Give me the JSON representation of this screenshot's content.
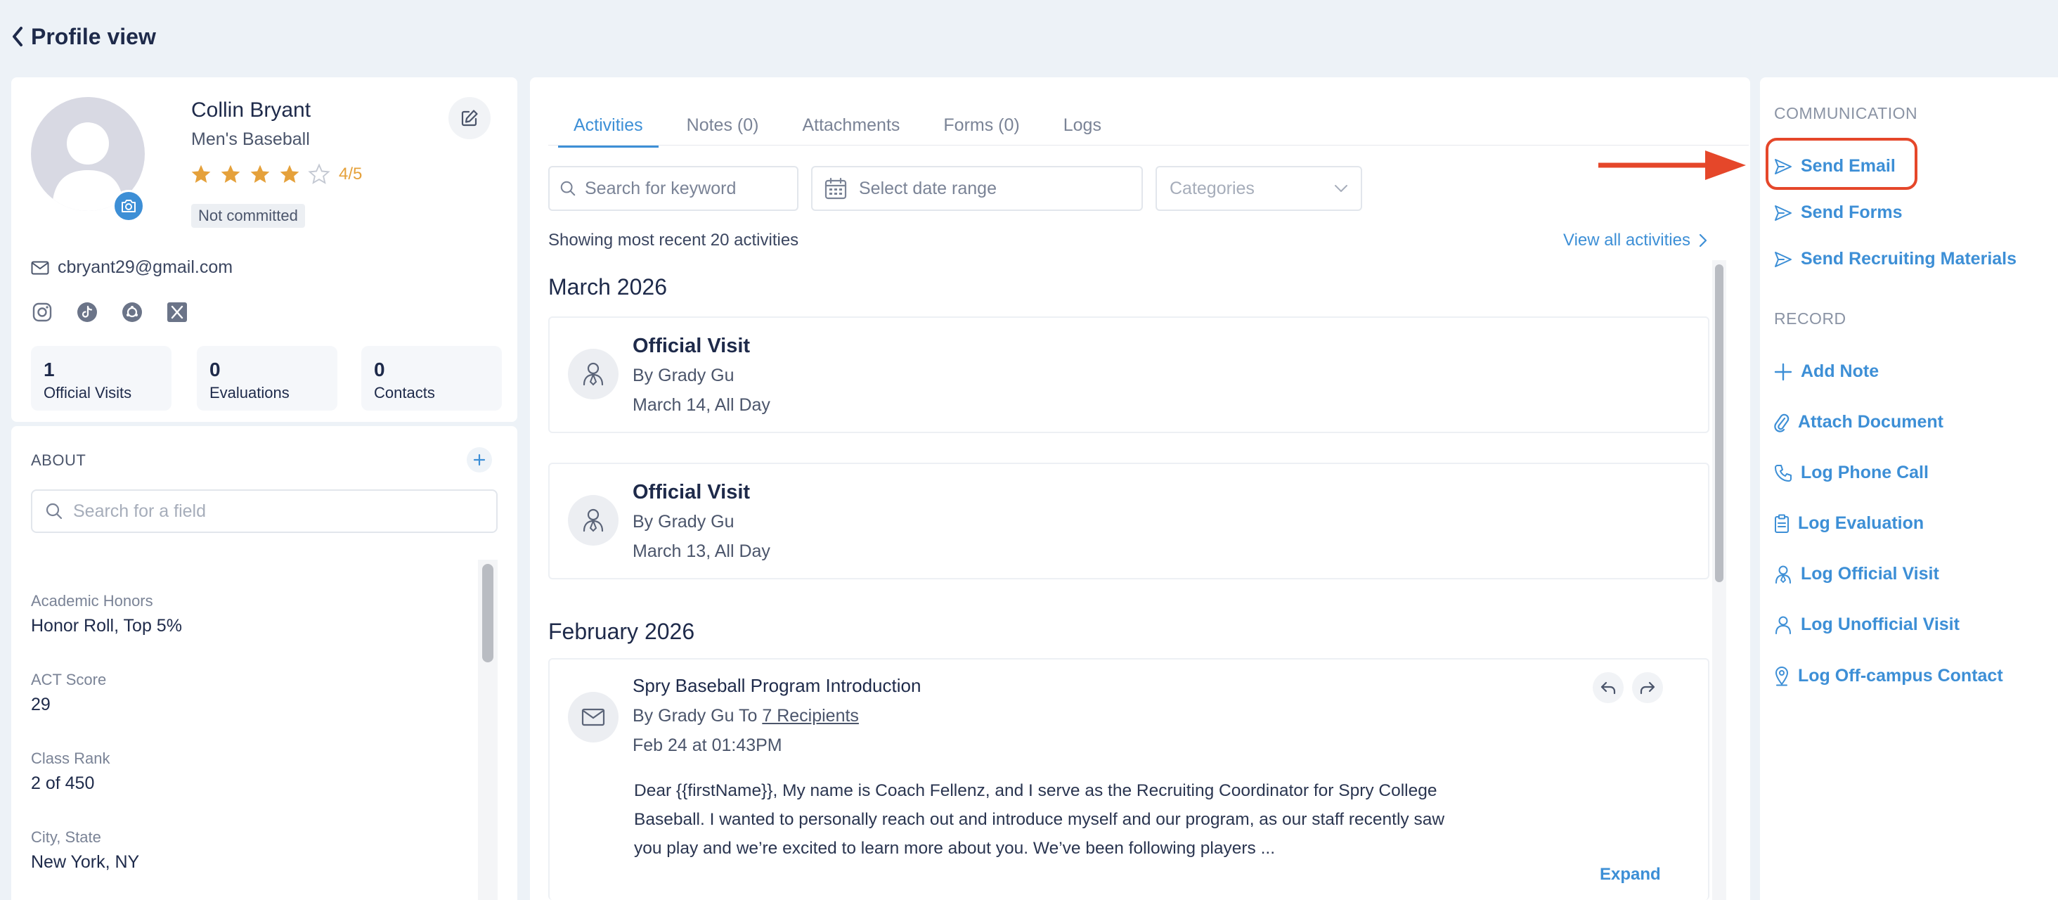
{
  "header": {
    "title": "Profile view"
  },
  "profile": {
    "name": "Collin Bryant",
    "sport": "Men's Baseball",
    "rating": "4/5",
    "stars_filled": 4,
    "stars_total": 5,
    "status": "Not committed",
    "email": "cbryant29@gmail.com",
    "socials": [
      "instagram-icon",
      "tiktok-icon",
      "threads-icon",
      "x-icon"
    ],
    "stats": [
      {
        "value": "1",
        "label": "Official Visits"
      },
      {
        "value": "0",
        "label": "Evaluations"
      },
      {
        "value": "0",
        "label": "Contacts"
      }
    ]
  },
  "about": {
    "heading": "ABOUT",
    "search_placeholder": "Search for a field",
    "fields": [
      {
        "label": "Academic Honors",
        "value": "Honor Roll, Top 5%"
      },
      {
        "label": "ACT Score",
        "value": "29"
      },
      {
        "label": "Class Rank",
        "value": "2 of 450"
      },
      {
        "label": "City, State",
        "value": "New York, NY"
      }
    ]
  },
  "tabs": [
    {
      "label": "Activities",
      "active": true
    },
    {
      "label": "Notes (0)",
      "active": false
    },
    {
      "label": "Attachments",
      "active": false
    },
    {
      "label": "Forms (0)",
      "active": false
    },
    {
      "label": "Logs",
      "active": false
    }
  ],
  "filters": {
    "search_placeholder": "Search for keyword",
    "date_placeholder": "Select date range",
    "category_placeholder": "Categories"
  },
  "activities": {
    "showing": "Showing most recent 20 activities",
    "view_all": "View all activities",
    "groups": [
      {
        "month": "March 2026",
        "items": [
          {
            "title": "Official Visit",
            "by": "By Grady Gu",
            "date": "March 14, All Day"
          },
          {
            "title": "Official Visit",
            "by": "By Grady Gu",
            "date": "March 13, All Day"
          }
        ]
      },
      {
        "month": "February 2026",
        "email": {
          "subject": "Spry Baseball Program Introduction",
          "by": "By Grady Gu To ",
          "recipients": "7 Recipients",
          "date": "Feb 24 at 01:43PM",
          "body": "Dear {{firstName}}, My name is Coach Fellenz, and I serve as the Recruiting Coordinator for Spry College Baseball. I wanted to personally reach out and introduce myself and our program, as our staff recently saw you play and we’re excited to learn more about you. We’ve been following players ...",
          "expand": "Expand"
        }
      }
    ]
  },
  "sidebar": {
    "communication_heading": "COMMUNICATION",
    "communication": [
      {
        "label": "Send Email",
        "icon": "send-icon"
      },
      {
        "label": "Send Forms",
        "icon": "send-icon"
      },
      {
        "label": "Send Recruiting Materials",
        "icon": "send-icon"
      }
    ],
    "record_heading": "RECORD",
    "record": [
      {
        "label": "Add Note",
        "icon": "plus-icon"
      },
      {
        "label": "Attach Document",
        "icon": "paperclip-icon"
      },
      {
        "label": "Log Phone Call",
        "icon": "phone-icon"
      },
      {
        "label": "Log Evaluation",
        "icon": "clipboard-icon"
      },
      {
        "label": "Log Official Visit",
        "icon": "official-visit-icon"
      },
      {
        "label": "Log Unofficial Visit",
        "icon": "user-icon"
      },
      {
        "label": "Log Off-campus Contact",
        "icon": "location-pin-icon"
      }
    ]
  },
  "colors": {
    "accent": "#3d8fd6",
    "highlight": "#e5472a",
    "star": "#e5a13b"
  }
}
